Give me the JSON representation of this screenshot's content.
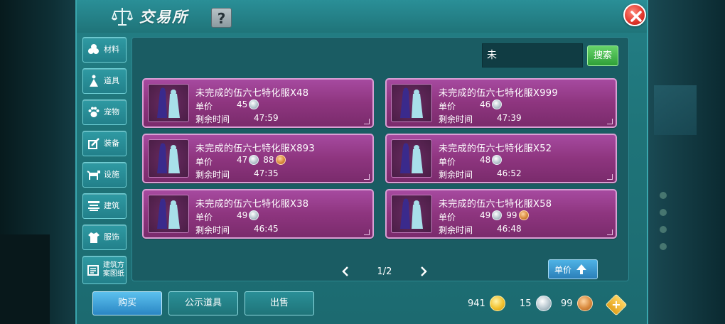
{
  "header": {
    "title": "交易所",
    "help_label": "?"
  },
  "sidebar": {
    "items": [
      {
        "label": "材料",
        "icon": "materials-icon"
      },
      {
        "label": "道具",
        "icon": "item-icon"
      },
      {
        "label": "宠物",
        "icon": "pet-paw-icon"
      },
      {
        "label": "装备",
        "icon": "equipment-icon"
      },
      {
        "label": "设施",
        "icon": "facility-icon"
      },
      {
        "label": "建筑",
        "icon": "building-icon"
      },
      {
        "label": "服饰",
        "icon": "clothing-icon"
      },
      {
        "label": "建筑方案图纸",
        "icon": "blueprint-icon"
      }
    ]
  },
  "search": {
    "value": "未",
    "button_label": "搜索"
  },
  "listings": [
    {
      "name": "未完成的伍六七特化服X48",
      "price_label": "单价",
      "price_silver": "45",
      "price_bronze": "",
      "time_label": "剩余时间",
      "time": "47:59"
    },
    {
      "name": "未完成的伍六七特化服X999",
      "price_label": "单价",
      "price_silver": "46",
      "price_bronze": "",
      "time_label": "剩余时间",
      "time": "47:39"
    },
    {
      "name": "未完成的伍六七特化服X893",
      "price_label": "单价",
      "price_silver": "47",
      "price_bronze": "88",
      "time_label": "剩余时间",
      "time": "47:35"
    },
    {
      "name": "未完成的伍六七特化服X52",
      "price_label": "单价",
      "price_silver": "48",
      "price_bronze": "",
      "time_label": "剩余时间",
      "time": "46:52"
    },
    {
      "name": "未完成的伍六七特化服X38",
      "price_label": "单价",
      "price_silver": "49",
      "price_bronze": "",
      "time_label": "剩余时间",
      "time": "46:45"
    },
    {
      "name": "未完成的伍六七特化服X58",
      "price_label": "单价",
      "price_silver": "49",
      "price_bronze": "99",
      "time_label": "剩余时间",
      "time": "46:48"
    }
  ],
  "pager": {
    "label": "1/2"
  },
  "sort": {
    "label": "单价"
  },
  "bottom": {
    "buy_label": "购买",
    "notice_label": "公示道具",
    "sell_label": "出售"
  },
  "currency": {
    "gold": "941",
    "silver": "15",
    "bronze": "99"
  },
  "colors": {
    "panel": "#1f7479",
    "card": "#8e357f",
    "search_button": "#2fa038",
    "close_button": "#e0352b"
  }
}
